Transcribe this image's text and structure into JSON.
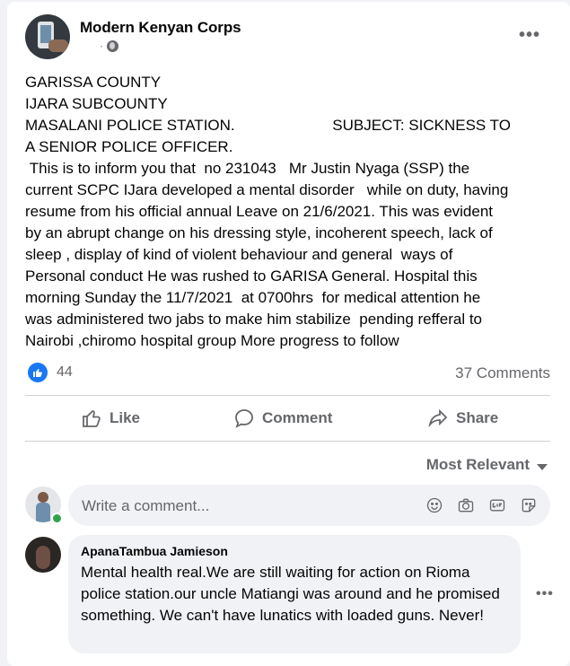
{
  "post": {
    "author": "Modern Kenyan Corps",
    "meta_separator": "·",
    "more_label": "•••",
    "text": "GARISSA COUNTY\nIJARA SUBCOUNTY\nMASALANI POLICE STATION.                       SUBJECT: SICKNESS TO\nA SENIOR POLICE OFFICER.\n This is to inform you that  no 231043   Mr Justin Nyaga (SSP) the\ncurrent SCPC IJara developed a mental disorder   while on duty, having\nresume from his official annual Leave on 21/6/2021. This was evident\nby an abrupt change on his dressing style, incoherent speech, lack of\nsleep , display of kind of violent behaviour and general  ways of\nPersonal conduct He was rushed to GARISA General. Hospital this\nmorning Sunday the 11/7/2021  at 0700hrs  for medical attention he\nwas administered two jabs to make him stabilize  pending refferal to\nNairobi ,chiromo hospital group More progress to follow",
    "like_count": "44",
    "comments_count": "37 Comments"
  },
  "actions": {
    "like": "Like",
    "comment": "Comment",
    "share": "Share"
  },
  "sort_label": "Most Relevant",
  "comment_input": {
    "placeholder": "Write a comment..."
  },
  "comments": [
    {
      "author": "ApanaTambua Jamieson",
      "text": "Mental health real.We are still waiting for action on Rioma police station.our uncle Matiangi was around and he promised something. We can't have lunatics with loaded guns. Never!",
      "more_label": "•••"
    }
  ],
  "colors": {
    "accent": "#1877f2",
    "secondary_text": "#65676b",
    "online": "#31a24c"
  }
}
